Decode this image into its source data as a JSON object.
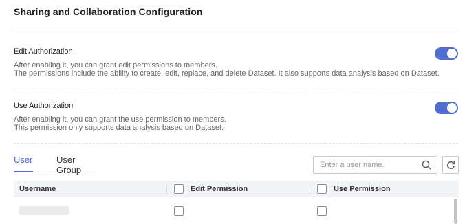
{
  "page": {
    "title": "Sharing and Collaboration Configuration"
  },
  "edit_authorization": {
    "label": "Edit Authorization",
    "desc_line1": "After enabling it, you can grant edit permissions to members.",
    "desc_line2": "The permissions include the ability to create, edit, replace, and delete Dataset. It also supports data analysis based on Dataset.",
    "enabled": true
  },
  "use_authorization": {
    "label": "Use Authorization",
    "desc_line1": "After enabling it, you can grant the use permission to members.",
    "desc_line2": "This permission only supports data analysis based on Dataset.",
    "enabled": true
  },
  "tabs": [
    {
      "label": "User",
      "active": true
    },
    {
      "label": "User Group",
      "active": false
    }
  ],
  "search": {
    "placeholder": "Enter a user name.",
    "value": ""
  },
  "table": {
    "columns": {
      "username": "Username",
      "edit_permission": "Edit Permission",
      "use_permission": "Use Permission"
    },
    "rows": [
      {
        "username_masked": true,
        "edit_permission": false,
        "use_permission": false
      }
    ]
  },
  "colors": {
    "accent": "#526ecc",
    "header_bg": "#f2f4f8"
  },
  "icons": {
    "search": "search-icon",
    "refresh": "refresh-icon"
  }
}
